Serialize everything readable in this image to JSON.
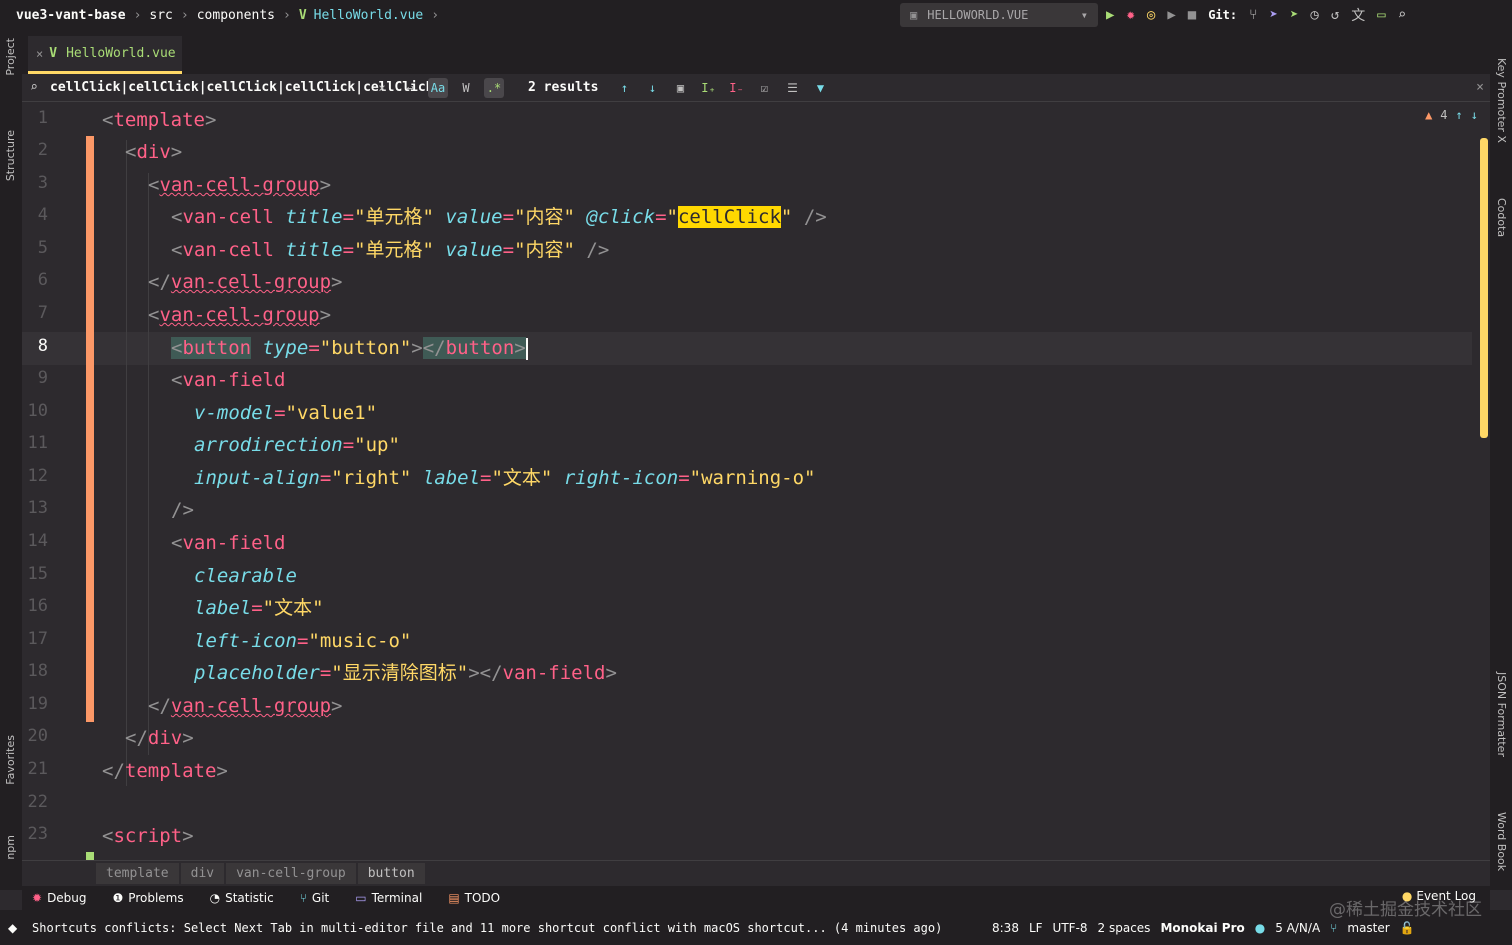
{
  "breadcrumbs": [
    "vue3-vant-base",
    "src",
    "components",
    "HelloWorld.vue"
  ],
  "run_config": "HELLOWORLD.VUE",
  "git_label": "Git:",
  "tab": {
    "label": "HelloWorld.vue"
  },
  "left_panels": {
    "project": "Project",
    "structure": "Structure",
    "favorites": "Favorites",
    "npm": "npm"
  },
  "right_panels": {
    "key_promoter": "Key Promoter X",
    "codota": "Codota",
    "json_formatter": "JSON Formatter",
    "word_book": "Word Book"
  },
  "find": {
    "query": "cellClick|cellClick|cellClick|cellClick|cellClick",
    "match_case": "Aa",
    "words": "W",
    "regex": ".*",
    "results": "2 results"
  },
  "warnings": {
    "count": "4"
  },
  "line_numbers": [
    "1",
    "2",
    "3",
    "4",
    "5",
    "6",
    "7",
    "8",
    "9",
    "10",
    "11",
    "12",
    "13",
    "14",
    "15",
    "16",
    "17",
    "18",
    "19",
    "20",
    "21",
    "22",
    "23"
  ],
  "current_line": "8",
  "code": {
    "l1_tag": "template",
    "l2_tag": "div",
    "l3_tag": "van-cell-group",
    "l4_tag": "van-cell",
    "l4_a1": "title",
    "l4_v1": "\"单元格\"",
    "l4_a2": "value",
    "l4_v2": "\"内容\"",
    "l4_a3": "@click",
    "l4_q": "\"",
    "l4_hit": "cellClick",
    "l4_end": "/>",
    "l5_tag": "van-cell",
    "l5_a1": "title",
    "l5_v1": "\"单元格\"",
    "l5_a2": "value",
    "l5_v2": "\"内容\"",
    "l5_end": "/>",
    "l6_tag": "van-cell-group",
    "l7_tag": "van-cell-group",
    "l8_tag": "button",
    "l8_a1": "type",
    "l8_v1": "\"button\"",
    "l8_close": "button",
    "l9_tag": "van-field",
    "l10_a": "v-model",
    "l10_v": "\"value1\"",
    "l11_a": "arrodirection",
    "l11_v": "\"up\"",
    "l12_a1": "input-align",
    "l12_v1": "\"right\"",
    "l12_a2": "label",
    "l12_v2": "\"文本\"",
    "l12_a3": "right-icon",
    "l12_v3": "\"warning-o\"",
    "l13": "/>",
    "l14_tag": "van-field",
    "l15_a": "clearable",
    "l16_a": "label",
    "l16_v": "\"文本\"",
    "l17_a": "left-icon",
    "l17_v": "\"music-o\"",
    "l18_a": "placeholder",
    "l18_v": "\"显示清除图标\"",
    "l18_close": "van-field",
    "l19_tag": "van-cell-group",
    "l20_tag": "div",
    "l21_tag": "template",
    "l23_tag": "script"
  },
  "path_breadcrumb": [
    "template",
    "div",
    "van-cell-group",
    "button"
  ],
  "tool_windows": [
    "Debug",
    "Problems",
    "Statistic",
    "Git",
    "Terminal",
    "TODO"
  ],
  "event_log": "Event Log",
  "status": {
    "message": "Shortcuts conflicts: Select Next Tab in multi-editor file and 11 more shortcut conflict with macOS shortcut... (4 minutes ago)",
    "position": "8:38",
    "line_sep": "LF",
    "encoding": "UTF-8",
    "indent": "2 spaces",
    "theme": "Monokai Pro",
    "na": "5 A/N/A",
    "branch": "master"
  },
  "watermark": "@稀土掘金技术社区",
  "colors": {
    "accent": "#ffd866",
    "tag": "#ff6188",
    "attr": "#78dce8",
    "string": "#ffd866",
    "vcs_change": "#fc9867",
    "search_hit": "#ffd800"
  }
}
